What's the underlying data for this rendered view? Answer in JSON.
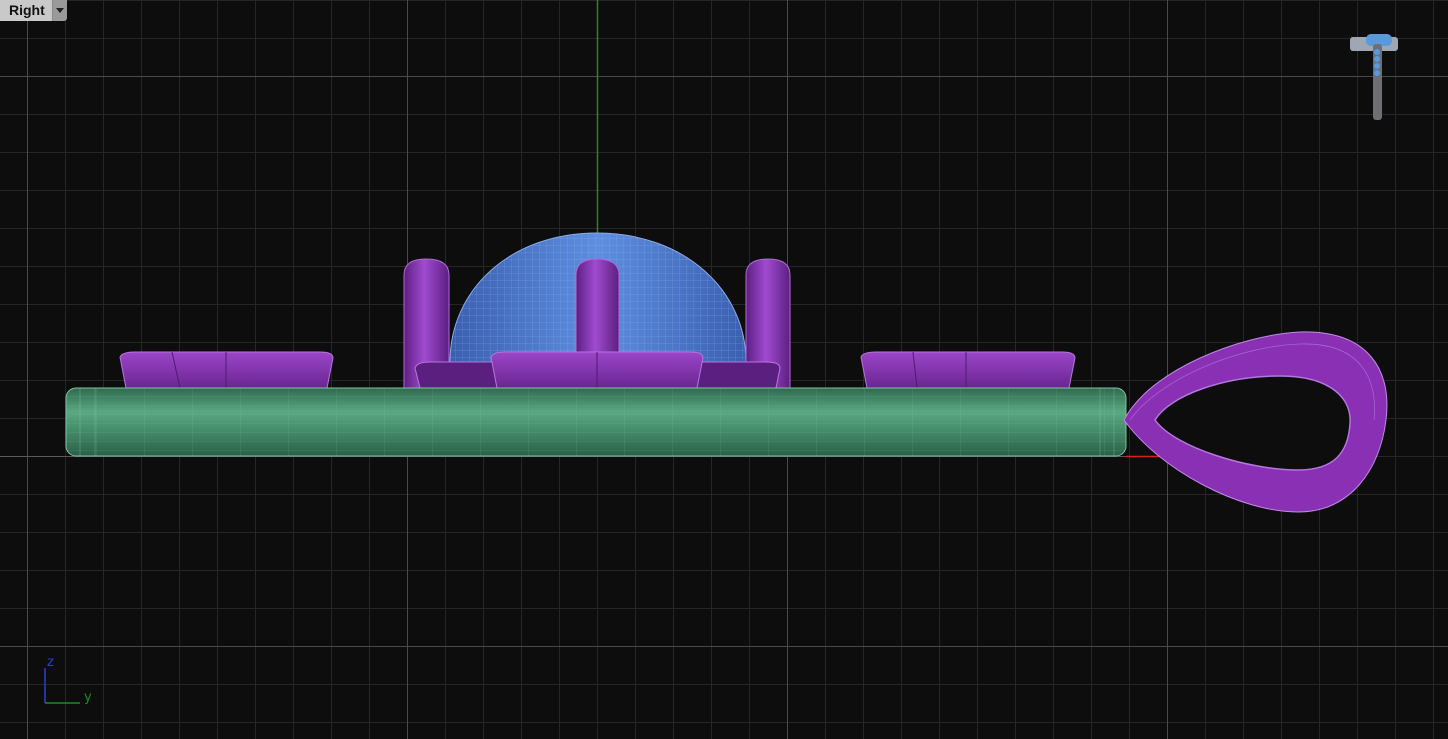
{
  "viewport": {
    "name": "Right",
    "background": "#0d0d0d",
    "grid_color": "#2d2d2d",
    "major_grid_color": "#4a4a4a"
  },
  "axes": {
    "z_axis_color": "#1e8c1e",
    "y_axis_color": "#d42020",
    "gizmo_label_z": "z",
    "gizmo_label_y": "y",
    "gizmo_z_color": "#2a40d0",
    "gizmo_y_color": "#1e8c1e"
  },
  "objects": {
    "base_bar": "#3f8a66",
    "dome": "#4a74c8",
    "prongs": "#7a2fa6",
    "loop": "#8a30b4"
  },
  "navigation_widget": {
    "icon": "ring-preview-icon"
  }
}
